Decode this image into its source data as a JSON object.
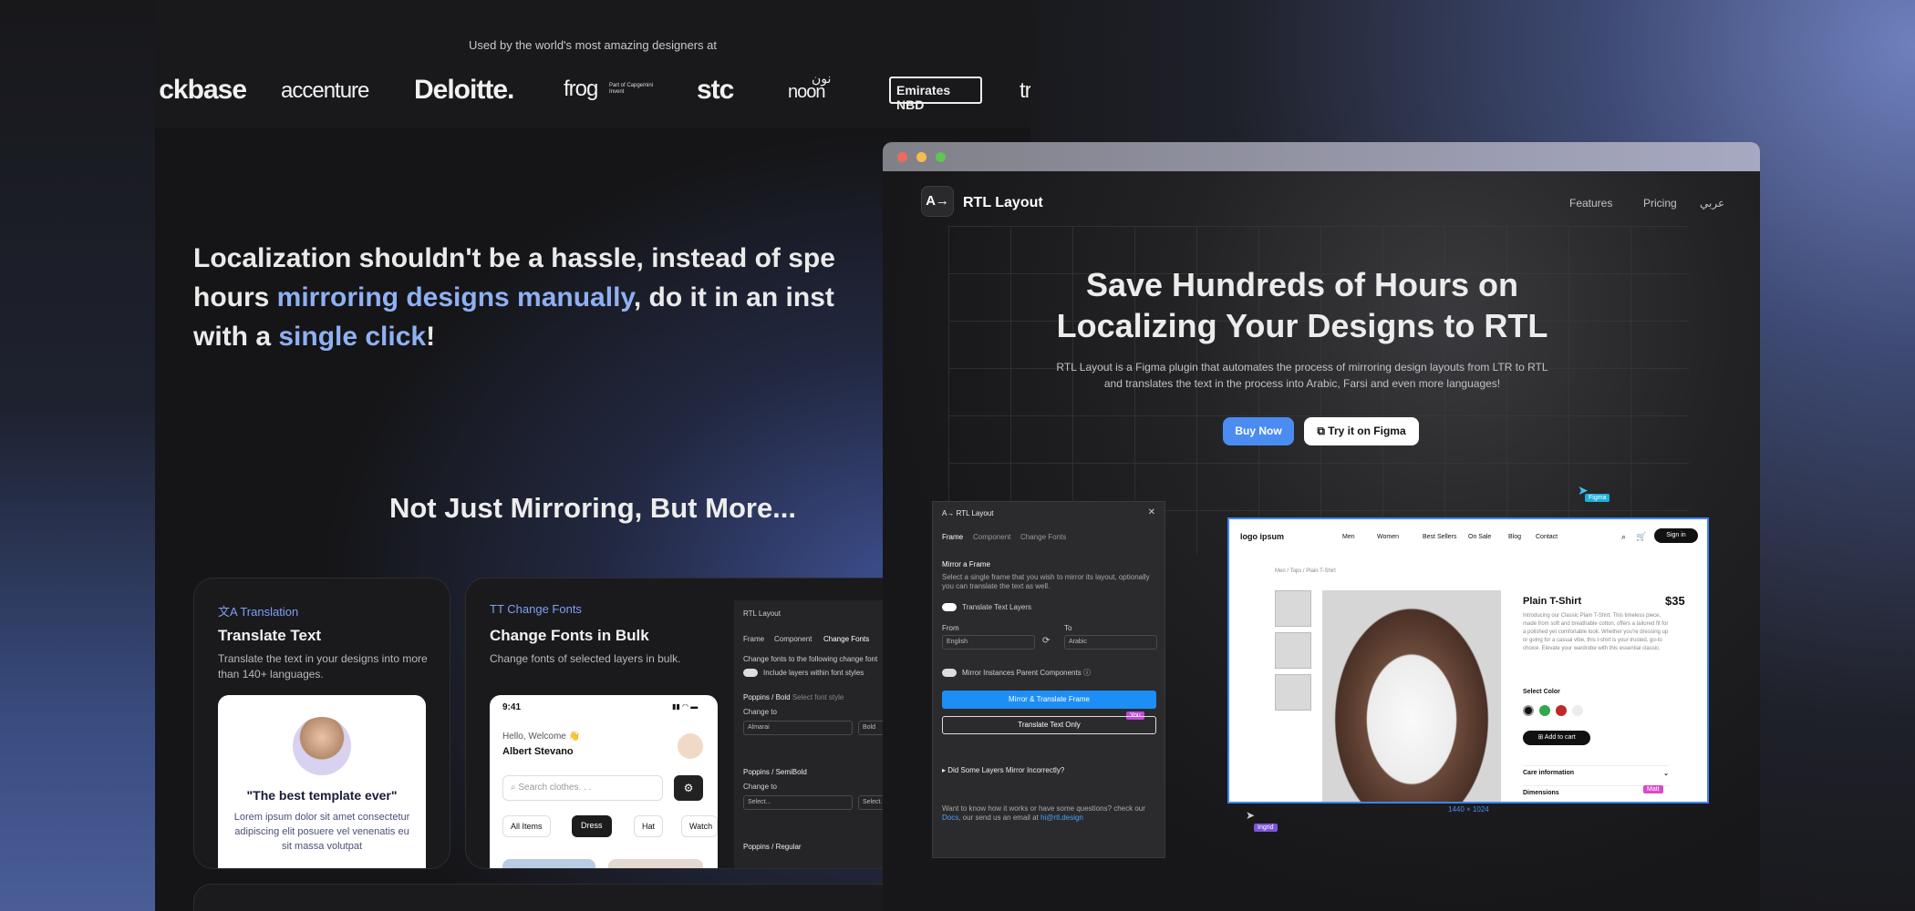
{
  "logos": {
    "caption": "Used by the world's most amazing designers at",
    "items": [
      "ckbase",
      "accenture",
      "Deloitte.",
      "frog",
      "stc",
      "noon",
      "Emirates NBD",
      "tr"
    ],
    "frog_sub": "Part of Capgemini Invent",
    "noon_arabic": "نون"
  },
  "hero": {
    "line1": "Localization shouldn't be a hassle, instead of spe",
    "line2_pre": "hours ",
    "line2_highlight": "mirroring designs manually",
    "line2_post": ", do it in an inst",
    "line3_pre": "with a ",
    "line3_highlight": "single click",
    "line3_post": "!"
  },
  "features": {
    "title": "Not Just Mirroring, But More...",
    "translate": {
      "tag": "Translation",
      "title": "Translate Text",
      "desc": "Translate the text in your designs into more than 140+ languages.",
      "quote": "\"The best template ever\"",
      "lorem": "Lorem ipsum dolor sit amet consectetur adipiscing elit posuere vel venenatis eu sit massa volutpat"
    },
    "fonts": {
      "tag": "Change Fonts",
      "title": "Change Fonts in Bulk",
      "desc": "Change fonts of selected layers in bulk.",
      "phone": {
        "time": "9:41",
        "welcome": "Hello, Welcome 👋",
        "name": "Albert Stevano",
        "search_placeholder": "Search clothes. . .",
        "chips": [
          "All Items",
          "Dress",
          "Hat",
          "Watch"
        ]
      },
      "panel": {
        "title": "RTL Layout",
        "tabs": [
          "Frame",
          "Component",
          "Change Fonts"
        ],
        "intro": "Change fonts to the following  change font",
        "include": "Include layers within font styles",
        "group1": "Poppins / Bold",
        "group1_hint": "Select font style",
        "change_to": "Change to",
        "font1": "Almarai",
        "font1_weight": "Bold",
        "group2": "Poppins / SemiBold",
        "select": "Select...",
        "group3": "Poppins / Regular"
      }
    }
  },
  "browser": {
    "brand": "RTL Layout",
    "logo_glyph": "A→",
    "nav": [
      "Features",
      "Pricing",
      "عربي"
    ],
    "title": "Save Hundreds of Hours on Localizing Your Designs to RTL",
    "subtitle": "RTL Layout is a Figma plugin that automates the process of mirroring design layouts from LTR to RTL and translates the text in the process into Arabic, Farsi and even more languages!",
    "buy": "Buy Now",
    "try": "Try it on Figma",
    "cursor_figma": "Figma",
    "size_label": "1440 × 1024",
    "cursor_ingrid": "Ingrid",
    "cursor_matt": "Matt"
  },
  "plugin": {
    "title": "RTL Layout",
    "tabs": [
      "Frame",
      "Component",
      "Change Fonts"
    ],
    "section": "Mirror a Frame",
    "desc": "Select a single frame that you wish to mirror its layout, optionally you can translate the text as well.",
    "translate_toggle": "Translate Text Layers",
    "from_label": "From",
    "to_label": "To",
    "from_value": "English",
    "to_value": "Arabic",
    "mirror_instances": "Mirror Instances Parent Components",
    "mirror_btn": "Mirror & Translate Frame",
    "translate_btn": "Translate Text Only",
    "you": "You",
    "faq": "Did Some Layers Mirror Incorrectly?",
    "footer_pre": "Want to know how it works or have some questions? check our ",
    "footer_link": "Docs",
    "footer_mid": ", our send us an email at ",
    "footer_email": "hi@rtl.design"
  },
  "shop": {
    "logo": "logo ipsum",
    "nav": [
      "Men",
      "Women",
      "Best Sellers",
      "On Sale",
      "Blog",
      "Contact"
    ],
    "signin": "Sign in",
    "breadcrumb": "Men / Tops / Plain T-Shirt",
    "product": "Plain T-Shirt",
    "price": "$35",
    "desc": "Introducing our Classic Plain T-Shirt. This timeless piece, made from soft and breathable cotton, offers a tailored fit for a polished yet comfortable look. Whether you're dressing up or going for a casual vibe, this t-shirt is your trusted, go-to choice. Elevate your wardrobe with this essential classic.",
    "select_color": "Select Color",
    "colors": [
      "#111111",
      "#2fa84f",
      "#c0282c",
      "#ececec"
    ],
    "add_to_cart": "Add to cart",
    "care": "Care information",
    "dimensions": "Dimensions"
  }
}
